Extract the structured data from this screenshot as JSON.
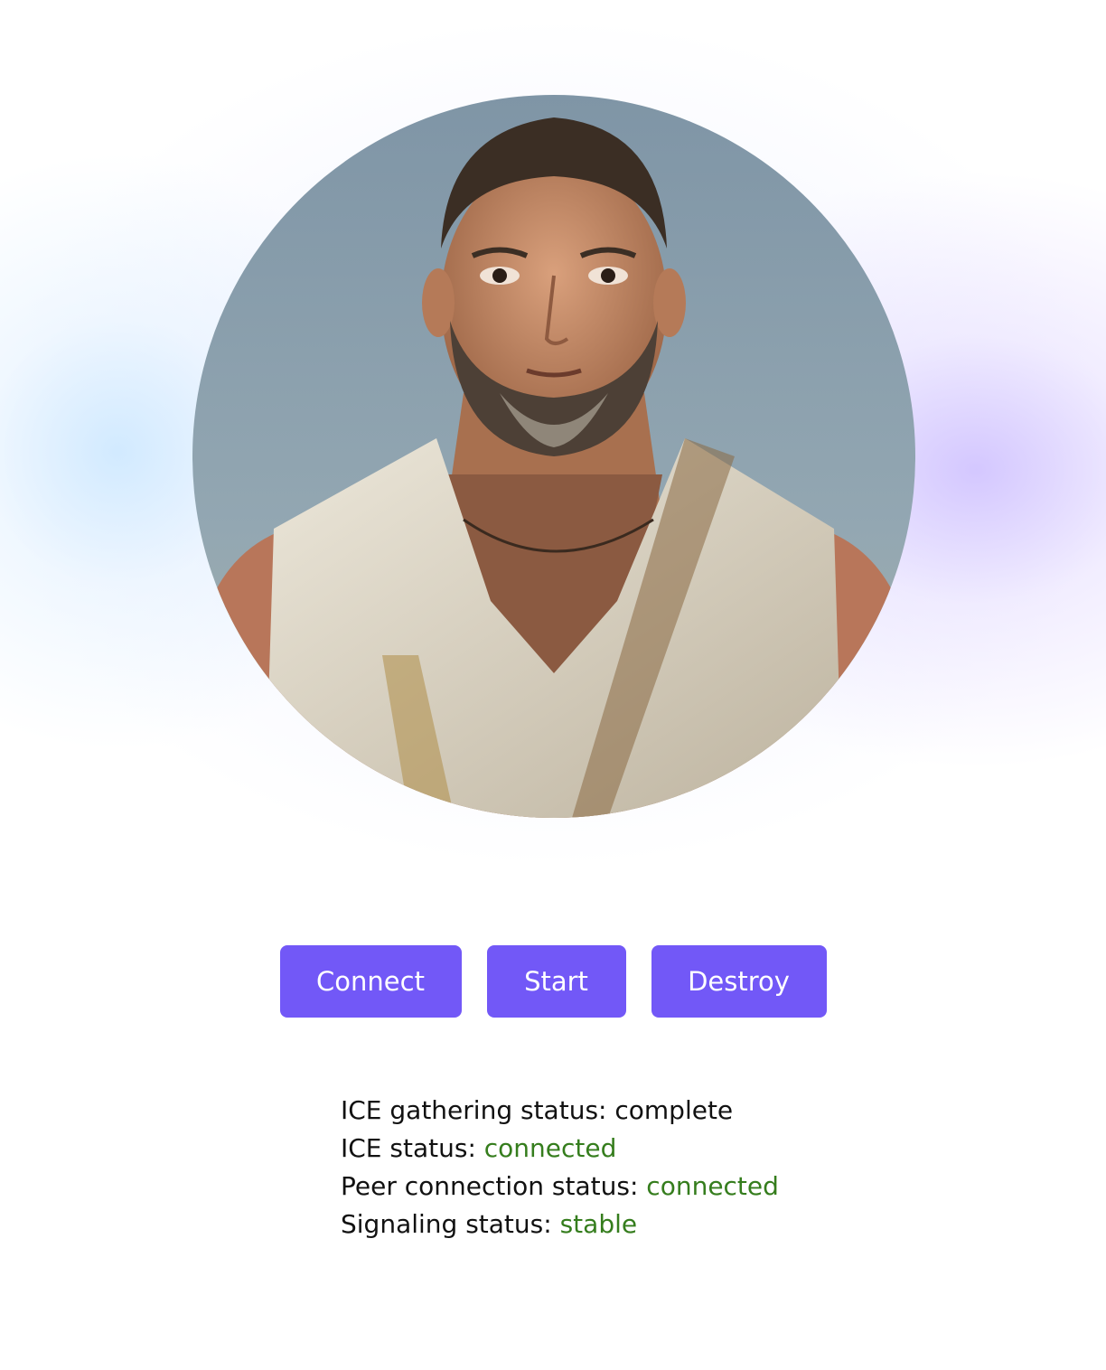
{
  "avatar": {
    "alt": "Agent avatar portrait"
  },
  "controls": {
    "connect_label": "Connect",
    "start_label": "Start",
    "destroy_label": "Destroy"
  },
  "status": {
    "ice_gathering": {
      "label": "ICE gathering status: ",
      "value": "complete"
    },
    "ice": {
      "label": "ICE status: ",
      "value": "connected"
    },
    "peer_connection": {
      "label": "Peer connection status: ",
      "value": "connected"
    },
    "signaling": {
      "label": "Signaling status: ",
      "value": "stable"
    }
  },
  "colors": {
    "button_bg": "#7258f7",
    "button_text": "#ffffff",
    "status_good": "#357d1d",
    "status_text": "#111111"
  }
}
